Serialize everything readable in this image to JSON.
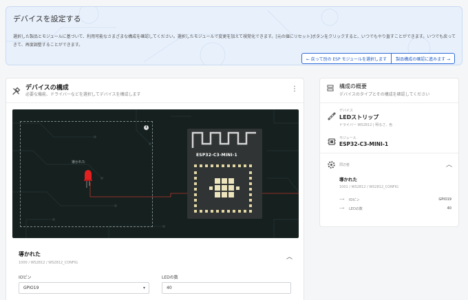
{
  "banner": {
    "title": "デバイスを設定する",
    "description": "選択した製品とモジュールに基づいて、利用可能なさまざまな構成を確認してください。選択したモジュールで変更を加えて視覚化できます。[元の値にリセット]ボタンをクリックすると、いつでもやり直すことができます。いつでも戻ってきて、再度調整することができます。",
    "back_button": "← 戻って別の ESP モジュールを選択します",
    "next_button": "製品構成の確認に進みます →"
  },
  "config": {
    "title": "デバイスの構成",
    "subtitle": "必要な機能、ドライバーなどを選択してデバイスを構成します",
    "canvas_label": "導かれた",
    "module_name": "ESP32-C3-MINI-1",
    "accordion_title": "導かれた",
    "accordion_path": "1000 / WS2812 / WS2812_CONFIG",
    "io_pin_label": "IOピン",
    "io_pin_value": "GPIO19",
    "led_count_label": "LEDの数",
    "led_count_value": "40"
  },
  "summary": {
    "title": "構成の概要",
    "subtitle": "デバイスのタイプとその構成を確認してください",
    "device_label": "デバイス",
    "device_value": "LEDストリップ",
    "device_sub": "ドライバー WS2812 | 明るさ、色",
    "module_label": "モジュール",
    "module_value": "ESP32-C3-MINI-1",
    "peripheral_label": "周辺者",
    "peripheral_value": "導かれた",
    "peripheral_path": "1001 / WS2812 / WS2812_CONFIG",
    "rows": [
      {
        "label": "IOピン",
        "value": "GPIO19"
      },
      {
        "label": "LEDの数",
        "value": "40"
      }
    ]
  },
  "icons": {
    "tools": "tools-icon",
    "more": "more-vertical-icon",
    "summary": "list-icon",
    "strip": "led-strip-icon",
    "chip": "chip-icon",
    "gear": "gear-icon",
    "chevron_up": "chevron-up-icon",
    "chevron_down": "chevron-down-icon",
    "info": "info-icon",
    "arrow": "arrow-right-icon"
  },
  "colors": {
    "accent": "#1f5bc5",
    "canvas_bg": "#15201f",
    "module_bg": "#303434",
    "led_red": "#e22020",
    "wire": "#c0392b"
  }
}
